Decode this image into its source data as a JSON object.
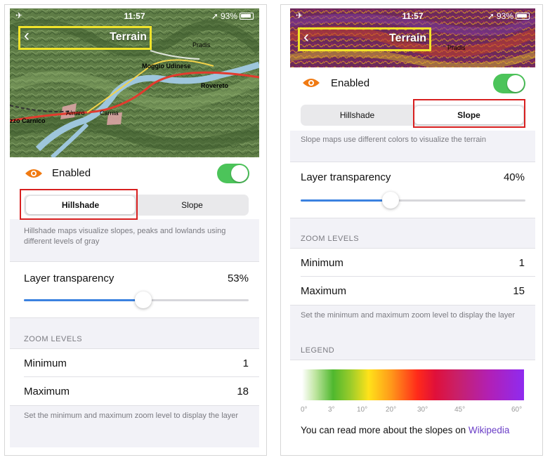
{
  "status": {
    "time": "11:57",
    "battery": "93%"
  },
  "nav": {
    "title": "Terrain"
  },
  "map_labels": [
    "Pradis",
    "Moggio Udinese",
    "Rovereto",
    "Amaro",
    "Carnia",
    "zzo Carnico"
  ],
  "left": {
    "enabled_label": "Enabled",
    "segments": [
      "Hillshade",
      "Slope"
    ],
    "selected_segment": "Hillshade",
    "description": "Hillshade maps visualize slopes, peaks and lowlands using different levels of gray",
    "transparency_label": "Layer transparency",
    "transparency_value": "53%",
    "transparency_fraction": 0.53,
    "zoom_section": "ZOOM LEVELS",
    "minimum_label": "Minimum",
    "minimum_value": "1",
    "maximum_label": "Maximum",
    "maximum_value": "18",
    "zoom_note": "Set the minimum and maximum zoom level to display the layer"
  },
  "right": {
    "enabled_label": "Enabled",
    "segments": [
      "Hillshade",
      "Slope"
    ],
    "selected_segment": "Slope",
    "description": "Slope maps use different colors to visualize the terrain",
    "transparency_label": "Layer transparency",
    "transparency_value": "40%",
    "transparency_fraction": 0.4,
    "zoom_section": "ZOOM LEVELS",
    "minimum_label": "Minimum",
    "minimum_value": "1",
    "maximum_label": "Maximum",
    "maximum_value": "15",
    "zoom_note": "Set the minimum and maximum zoom level to display the layer",
    "legend_section": "LEGEND",
    "legend_ticks": [
      "0°",
      "3°",
      "10°",
      "20°",
      "30°",
      "45°",
      "60°"
    ],
    "read_more_text": "You can read more about the slopes on ",
    "read_more_link": "Wikipedia"
  },
  "colors": {
    "toggle_on": "#4cc45a",
    "accent": "#3b82e0",
    "eye": "#f07a12",
    "link": "#6b3fc7",
    "highlight_yellow": "#f0e32a",
    "highlight_red": "#d82020"
  },
  "icons": {
    "back": "chevron-left-icon",
    "eye": "eye-icon",
    "airplane": "airplane-icon",
    "location": "location-arrow-icon",
    "battery": "battery-icon"
  }
}
